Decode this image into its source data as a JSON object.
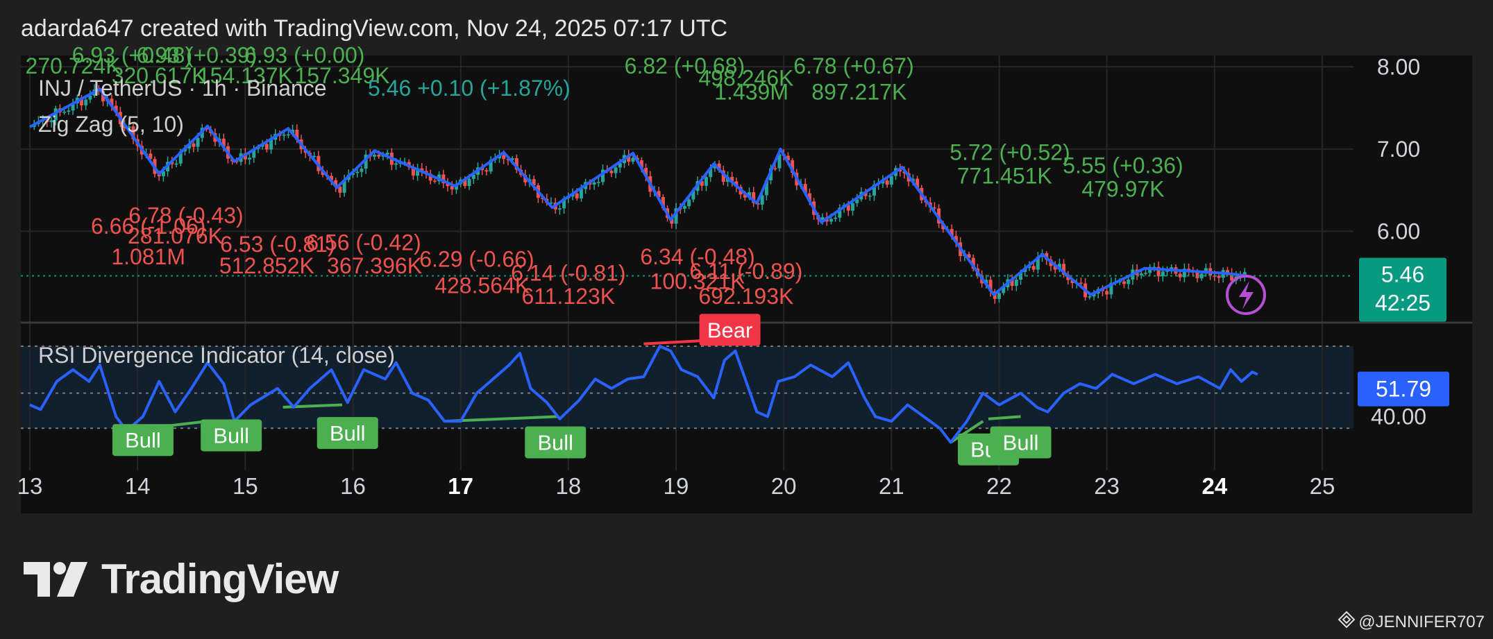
{
  "header": {
    "text": "adarda647 created with TradingView.com, Nov 24, 2025 07:17 UTC"
  },
  "brand": {
    "name": "TradingView",
    "logo_icon": "tradingview-logo-icon"
  },
  "watermark": {
    "text": "@JENNIFER707",
    "icon": "binance-diamond-icon"
  },
  "colors": {
    "background": "#1f1f1f",
    "panel": "#0f0f0f",
    "up": "#26a69a",
    "down": "#ef5350",
    "zigzag": "#2962ff",
    "rsi": "#2962ff",
    "bull": "#4caf50",
    "bear": "#f23645",
    "price_tag": "#089981",
    "rsi_tag": "#2962ff"
  },
  "chart_data": [
    {
      "type": "candlestick",
      "title": "INJ / TetherUS · 1h · Binance",
      "last_value_text": "5.46 +0.10 (+1.87%)",
      "indicator": "Zig Zag (5, 10)",
      "x_ticks": [
        "13",
        "14",
        "15",
        "16",
        "17",
        "18",
        "19",
        "20",
        "21",
        "22",
        "23",
        "24",
        "25"
      ],
      "x_ticks_bold": [
        "17",
        "24"
      ],
      "y_ticks": [
        "8.00",
        "7.00",
        "6.00"
      ],
      "ylim": [
        5.0,
        8.07
      ],
      "last_price": {
        "value": 5.46,
        "label": "5.46",
        "countdown": "42:25"
      },
      "zigzag": [
        {
          "x": 13.0,
          "y": 7.27
        },
        {
          "x": 13.65,
          "y": 7.73
        },
        {
          "x": 14.2,
          "y": 6.7
        },
        {
          "x": 14.65,
          "y": 7.28
        },
        {
          "x": 14.9,
          "y": 6.85
        },
        {
          "x": 15.4,
          "y": 7.25
        },
        {
          "x": 15.85,
          "y": 6.53
        },
        {
          "x": 16.2,
          "y": 6.98
        },
        {
          "x": 16.95,
          "y": 6.55
        },
        {
          "x": 17.4,
          "y": 6.96
        },
        {
          "x": 17.85,
          "y": 6.29
        },
        {
          "x": 18.6,
          "y": 6.95
        },
        {
          "x": 18.95,
          "y": 6.14
        },
        {
          "x": 19.35,
          "y": 6.82
        },
        {
          "x": 19.5,
          "y": 6.62
        },
        {
          "x": 19.75,
          "y": 6.34
        },
        {
          "x": 19.97,
          "y": 7.0
        },
        {
          "x": 20.35,
          "y": 6.11
        },
        {
          "x": 21.1,
          "y": 6.78
        },
        {
          "x": 21.95,
          "y": 5.23
        },
        {
          "x": 22.4,
          "y": 5.72
        },
        {
          "x": 22.85,
          "y": 5.23
        },
        {
          "x": 23.35,
          "y": 5.55
        },
        {
          "x": 24.1,
          "y": 5.49
        },
        {
          "x": 24.3,
          "y": 5.46
        }
      ],
      "pivot_labels": [
        {
          "x": 13.4,
          "y": 7.92,
          "text": "270.724K",
          "dir": "high"
        },
        {
          "x": 13.95,
          "y": 8.05,
          "text": "6.93 (+0.48)",
          "dir": "high"
        },
        {
          "x": 14.2,
          "y": 7.8,
          "text": "320.617K",
          "dir": "high"
        },
        {
          "x": 14.55,
          "y": 8.05,
          "text": "6.93 (+0.39)",
          "dir": "high"
        },
        {
          "x": 15.0,
          "y": 7.8,
          "text": "154.137K",
          "dir": "high"
        },
        {
          "x": 15.55,
          "y": 8.05,
          "text": "6.93 (+0.00)",
          "dir": "high"
        },
        {
          "x": 15.9,
          "y": 7.8,
          "text": "157.349K",
          "dir": "high"
        },
        {
          "x": 19.08,
          "y": 7.92,
          "text": "6.82 (+0.68)",
          "dir": "high"
        },
        {
          "x": 19.65,
          "y": 7.77,
          "text": "498.246K",
          "dir": "high"
        },
        {
          "x": 19.7,
          "y": 7.6,
          "text": "1.439M",
          "dir": "high"
        },
        {
          "x": 20.65,
          "y": 7.92,
          "text": "6.78 (+0.67)",
          "dir": "high"
        },
        {
          "x": 20.7,
          "y": 7.6,
          "text": "897.217K",
          "dir": "high"
        },
        {
          "x": 22.1,
          "y": 6.87,
          "text": "5.72 (+0.52)",
          "dir": "high"
        },
        {
          "x": 22.05,
          "y": 6.58,
          "text": "771.451K",
          "dir": "high"
        },
        {
          "x": 23.15,
          "y": 6.71,
          "text": "5.55 (+0.36)",
          "dir": "high"
        },
        {
          "x": 23.15,
          "y": 6.42,
          "text": "479.97K",
          "dir": "high"
        },
        {
          "x": 14.1,
          "y": 5.97,
          "text": "6.66 (-1.06)",
          "dir": "low"
        },
        {
          "x": 14.45,
          "y": 6.1,
          "text": "6.78 (-0.43)",
          "dir": "low"
        },
        {
          "x": 14.35,
          "y": 5.85,
          "text": "281.076K",
          "dir": "low"
        },
        {
          "x": 15.3,
          "y": 5.75,
          "text": "6.53 (-0.81)",
          "dir": "low"
        },
        {
          "x": 14.1,
          "y": 5.6,
          "text": "1.081M",
          "dir": "low"
        },
        {
          "x": 16.1,
          "y": 5.77,
          "text": "6.56 (-0.42)",
          "dir": "low"
        },
        {
          "x": 15.2,
          "y": 5.49,
          "text": "512.852K",
          "dir": "low"
        },
        {
          "x": 16.2,
          "y": 5.49,
          "text": "367.396K",
          "dir": "low"
        },
        {
          "x": 17.15,
          "y": 5.57,
          "text": "6.29 (-0.66)",
          "dir": "low"
        },
        {
          "x": 17.2,
          "y": 5.25,
          "text": "428.564K",
          "dir": "low"
        },
        {
          "x": 18.0,
          "y": 5.4,
          "text": "6.14 (-0.81)",
          "dir": "low"
        },
        {
          "x": 18.0,
          "y": 5.12,
          "text": "611.123K",
          "dir": "low"
        },
        {
          "x": 19.2,
          "y": 5.6,
          "text": "6.34 (-0.48)",
          "dir": "low"
        },
        {
          "x": 19.2,
          "y": 5.3,
          "text": "100.321K",
          "dir": "low"
        },
        {
          "x": 19.65,
          "y": 5.42,
          "text": "6.11 (-0.89)",
          "dir": "low"
        },
        {
          "x": 19.65,
          "y": 5.12,
          "text": "692.193K",
          "dir": "low"
        }
      ]
    },
    {
      "type": "line",
      "title": "RSI Divergence Indicator (14, close)",
      "ylim": [
        20,
        78
      ],
      "y_ticks": [
        "40.00"
      ],
      "band": [
        35,
        70
      ],
      "last_value": {
        "value": 51.79,
        "label": "51.79"
      },
      "anchors": [
        {
          "x": 13.0,
          "y": 45
        },
        {
          "x": 13.1,
          "y": 43
        },
        {
          "x": 13.25,
          "y": 55
        },
        {
          "x": 13.4,
          "y": 60
        },
        {
          "x": 13.55,
          "y": 55
        },
        {
          "x": 13.65,
          "y": 62
        },
        {
          "x": 13.8,
          "y": 40
        },
        {
          "x": 13.9,
          "y": 34
        },
        {
          "x": 14.05,
          "y": 40
        },
        {
          "x": 14.2,
          "y": 55
        },
        {
          "x": 14.35,
          "y": 42
        },
        {
          "x": 14.5,
          "y": 52
        },
        {
          "x": 14.65,
          "y": 63
        },
        {
          "x": 14.8,
          "y": 54
        },
        {
          "x": 14.9,
          "y": 38
        },
        {
          "x": 15.05,
          "y": 45
        },
        {
          "x": 15.3,
          "y": 52
        },
        {
          "x": 15.45,
          "y": 44
        },
        {
          "x": 15.6,
          "y": 52
        },
        {
          "x": 15.8,
          "y": 60
        },
        {
          "x": 15.95,
          "y": 46
        },
        {
          "x": 16.1,
          "y": 60
        },
        {
          "x": 16.3,
          "y": 56
        },
        {
          "x": 16.4,
          "y": 63
        },
        {
          "x": 16.55,
          "y": 50
        },
        {
          "x": 16.7,
          "y": 47
        },
        {
          "x": 16.85,
          "y": 38
        },
        {
          "x": 17.0,
          "y": 38
        },
        {
          "x": 17.15,
          "y": 50
        },
        {
          "x": 17.3,
          "y": 56
        },
        {
          "x": 17.45,
          "y": 62
        },
        {
          "x": 17.55,
          "y": 67
        },
        {
          "x": 17.65,
          "y": 52
        },
        {
          "x": 17.8,
          "y": 46
        },
        {
          "x": 17.92,
          "y": 39
        },
        {
          "x": 18.1,
          "y": 47
        },
        {
          "x": 18.25,
          "y": 56
        },
        {
          "x": 18.4,
          "y": 52
        },
        {
          "x": 18.55,
          "y": 56
        },
        {
          "x": 18.7,
          "y": 57
        },
        {
          "x": 18.85,
          "y": 70
        },
        {
          "x": 18.95,
          "y": 68
        },
        {
          "x": 19.05,
          "y": 60
        },
        {
          "x": 19.2,
          "y": 57
        },
        {
          "x": 19.35,
          "y": 48
        },
        {
          "x": 19.45,
          "y": 64
        },
        {
          "x": 19.55,
          "y": 68
        },
        {
          "x": 19.65,
          "y": 55
        },
        {
          "x": 19.75,
          "y": 42
        },
        {
          "x": 19.85,
          "y": 40
        },
        {
          "x": 19.95,
          "y": 55
        },
        {
          "x": 20.1,
          "y": 57
        },
        {
          "x": 20.25,
          "y": 62
        },
        {
          "x": 20.45,
          "y": 57
        },
        {
          "x": 20.6,
          "y": 63
        },
        {
          "x": 20.75,
          "y": 48
        },
        {
          "x": 20.85,
          "y": 40
        },
        {
          "x": 21.0,
          "y": 38
        },
        {
          "x": 21.15,
          "y": 45
        },
        {
          "x": 21.3,
          "y": 40
        },
        {
          "x": 21.45,
          "y": 35
        },
        {
          "x": 21.55,
          "y": 29
        },
        {
          "x": 21.7,
          "y": 38
        },
        {
          "x": 21.85,
          "y": 50
        },
        {
          "x": 22.0,
          "y": 45
        },
        {
          "x": 22.2,
          "y": 50
        },
        {
          "x": 22.35,
          "y": 44
        },
        {
          "x": 22.45,
          "y": 42
        },
        {
          "x": 22.6,
          "y": 50
        },
        {
          "x": 22.75,
          "y": 54
        },
        {
          "x": 22.9,
          "y": 52
        },
        {
          "x": 23.05,
          "y": 58
        },
        {
          "x": 23.25,
          "y": 54
        },
        {
          "x": 23.45,
          "y": 58
        },
        {
          "x": 23.65,
          "y": 54
        },
        {
          "x": 23.85,
          "y": 57
        },
        {
          "x": 24.05,
          "y": 52
        },
        {
          "x": 24.15,
          "y": 60
        },
        {
          "x": 24.25,
          "y": 55
        },
        {
          "x": 24.35,
          "y": 59
        },
        {
          "x": 24.4,
          "y": 58
        }
      ],
      "divergences": [
        {
          "type": "Bull",
          "x1": 13.9,
          "y1": 34,
          "x2": 14.65,
          "y2": 38,
          "lx": 14.05,
          "ly": 30,
          "label": "Bull"
        },
        {
          "type": "Bull",
          "x1": 14.65,
          "y1": 38,
          "x2": 15.0,
          "y2": 38,
          "lx": 14.87,
          "ly": 32,
          "label": "Bull"
        },
        {
          "type": "Bull",
          "x1": 15.35,
          "y1": 44,
          "x2": 15.9,
          "y2": 45,
          "lx": 15.95,
          "ly": 33,
          "label": "Bull"
        },
        {
          "type": "Bull",
          "x1": 16.85,
          "y1": 38,
          "x2": 17.9,
          "y2": 40,
          "lx": 17.88,
          "ly": 29,
          "label": "Bull"
        },
        {
          "type": "Bull",
          "x1": 21.55,
          "y1": 29,
          "x2": 21.85,
          "y2": 38,
          "lx": 21.9,
          "ly": 26,
          "label": "Bull"
        },
        {
          "type": "Bull",
          "x1": 21.9,
          "y1": 39,
          "x2": 22.2,
          "y2": 40,
          "lx": 22.2,
          "ly": 29,
          "label": "Bull"
        },
        {
          "type": "Bear",
          "x1": 18.7,
          "y1": 71,
          "x2": 19.5,
          "y2": 73,
          "lx": 19.5,
          "ly": 77,
          "label": "Bear"
        }
      ]
    }
  ]
}
